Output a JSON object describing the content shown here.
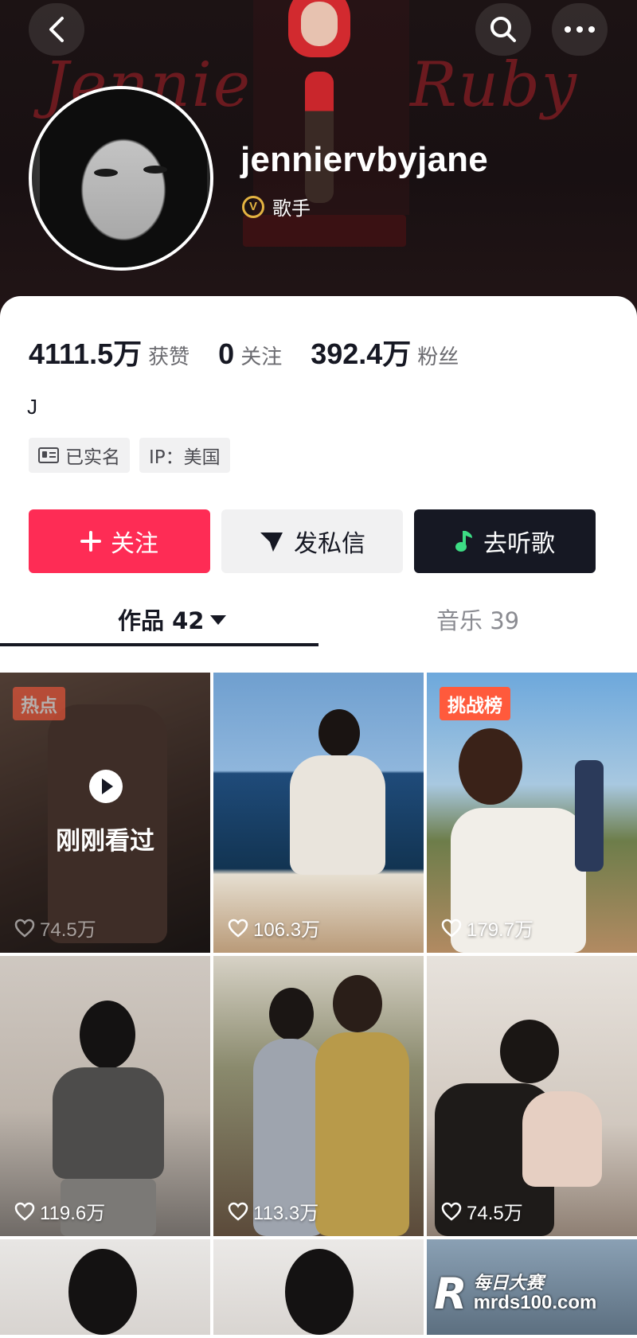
{
  "header": {
    "banner_text_left": "Jennie",
    "banner_text_right": "Ruby",
    "username": "jenniervbyjane",
    "verified_label": "歌手",
    "verified_icon_letter": "V"
  },
  "stats": [
    {
      "value": "4111.5万",
      "label": "获赞"
    },
    {
      "value": "0",
      "label": "关注"
    },
    {
      "value": "392.4万",
      "label": "粉丝"
    }
  ],
  "bio": "J",
  "tags": {
    "verified_name": "已实名",
    "ip": "IP：美国"
  },
  "actions": {
    "follow": "关注",
    "message": "发私信",
    "music": "去听歌"
  },
  "tabs": {
    "works": "作品 42",
    "music": "音乐 39"
  },
  "videos": [
    {
      "likes": "74.5万",
      "badge": "热点",
      "overlay": "刚刚看过"
    },
    {
      "likes": "106.3万"
    },
    {
      "likes": "179.7万",
      "badge": "挑战榜"
    },
    {
      "likes": "119.6万"
    },
    {
      "likes": "113.3万"
    },
    {
      "likes": "74.5万"
    }
  ],
  "watermark": {
    "logo": "R",
    "line1": "每日大赛",
    "line2": "mrds100.com"
  },
  "colors": {
    "accent": "#fe2c55",
    "dark_button": "#161823",
    "badge": "#ff5a3c",
    "verified": "#e3b341"
  }
}
